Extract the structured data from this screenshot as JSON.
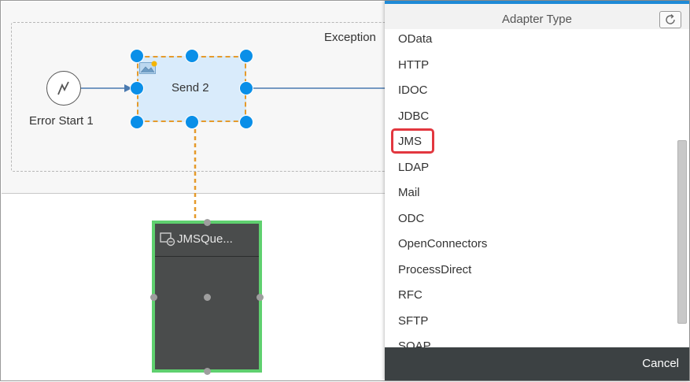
{
  "diagram": {
    "subprocess_title": "Exception",
    "start_event_label": "Error Start 1",
    "send_step_label": "Send 2",
    "receiver_label": "JMSQue..."
  },
  "adapter_panel": {
    "title": "Adapter Type",
    "items": [
      "OData",
      "HTTP",
      "IDOC",
      "JDBC",
      "JMS",
      "LDAP",
      "Mail",
      "ODC",
      "OpenConnectors",
      "ProcessDirect",
      "RFC",
      "SFTP",
      "SOAP"
    ],
    "highlighted_item": "JMS",
    "cancel_label": "Cancel"
  },
  "colors": {
    "selection_handle": "#0a8fe8",
    "send_fill": "#d9ebfb",
    "selected_dashed": "#e59a2b",
    "receiver_fill": "#4a4c4c",
    "receiver_border": "#5fd06f",
    "highlight": "#e2373f",
    "panel_accent": "#1e8ad6",
    "footer": "#3c4143"
  }
}
